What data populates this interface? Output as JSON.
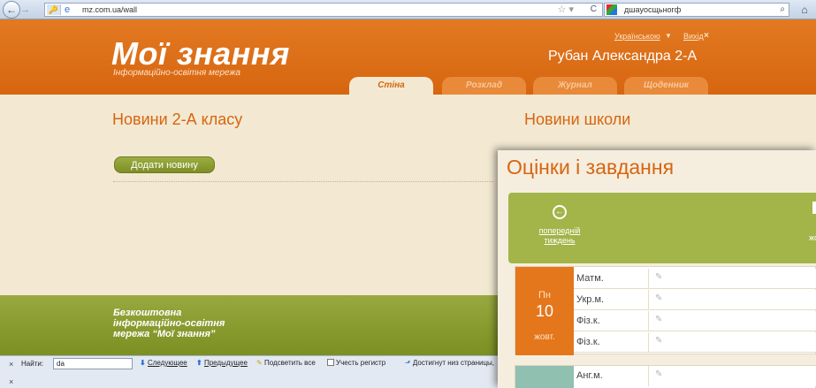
{
  "browser": {
    "url": "mz.com.ua/wall",
    "search_text": "дшаyoсщьногф",
    "back_glyph": "←",
    "forward_glyph": "→",
    "home_glyph": "⌂",
    "star_glyph": "☆ ▾",
    "reload_glyph": "C",
    "search_glyph": "⌕"
  },
  "header": {
    "logo": "Мої знання",
    "logo_subtitle": "Інформаційно-освітня мережа",
    "language_link": "Українською",
    "language_caret": "▼",
    "logout_link": "Вихід",
    "logout_x": "×",
    "user_name": "Рубан Александра  2-А",
    "tabs": [
      {
        "label": "Стіна",
        "active": true
      },
      {
        "label": "Розклад",
        "active": false
      },
      {
        "label": "Журнал",
        "active": false
      },
      {
        "label": "Щоденник",
        "active": false
      }
    ]
  },
  "main": {
    "news_class_title": "Новини 2-А класу",
    "add_news_button": "Додати новину",
    "news_school_title": "Новини школи"
  },
  "footer": {
    "line1": "Безкоштовна",
    "line2": "інформаційно-освітня",
    "line3": "мережа “Мої знання”"
  },
  "findbar": {
    "close": "×",
    "label": "Найти:",
    "query": "da",
    "next": "Следующее",
    "prev": "Предыдущее",
    "highlight_all": "Подсветить все",
    "match_case": "Учесть регистр",
    "status": "Достигнут низ страницы,"
  },
  "popup": {
    "title": "Оцінки і завдання",
    "prev_week_line1": "попередній",
    "prev_week_line2": "тиждень",
    "month_fragment": "жо",
    "day": {
      "dow": "Пн",
      "num": "10",
      "month": "жовт."
    },
    "subjects": [
      "Матм.",
      "Укр.м.",
      "Фіз.к.",
      "Фіз.к."
    ],
    "next_day_subject": "Анг.м.",
    "pencil_glyph": "✎"
  },
  "colors": {
    "brand_orange": "#d76510",
    "brand_green": "#8c9e2f",
    "page_bg": "#f3e9d2"
  }
}
